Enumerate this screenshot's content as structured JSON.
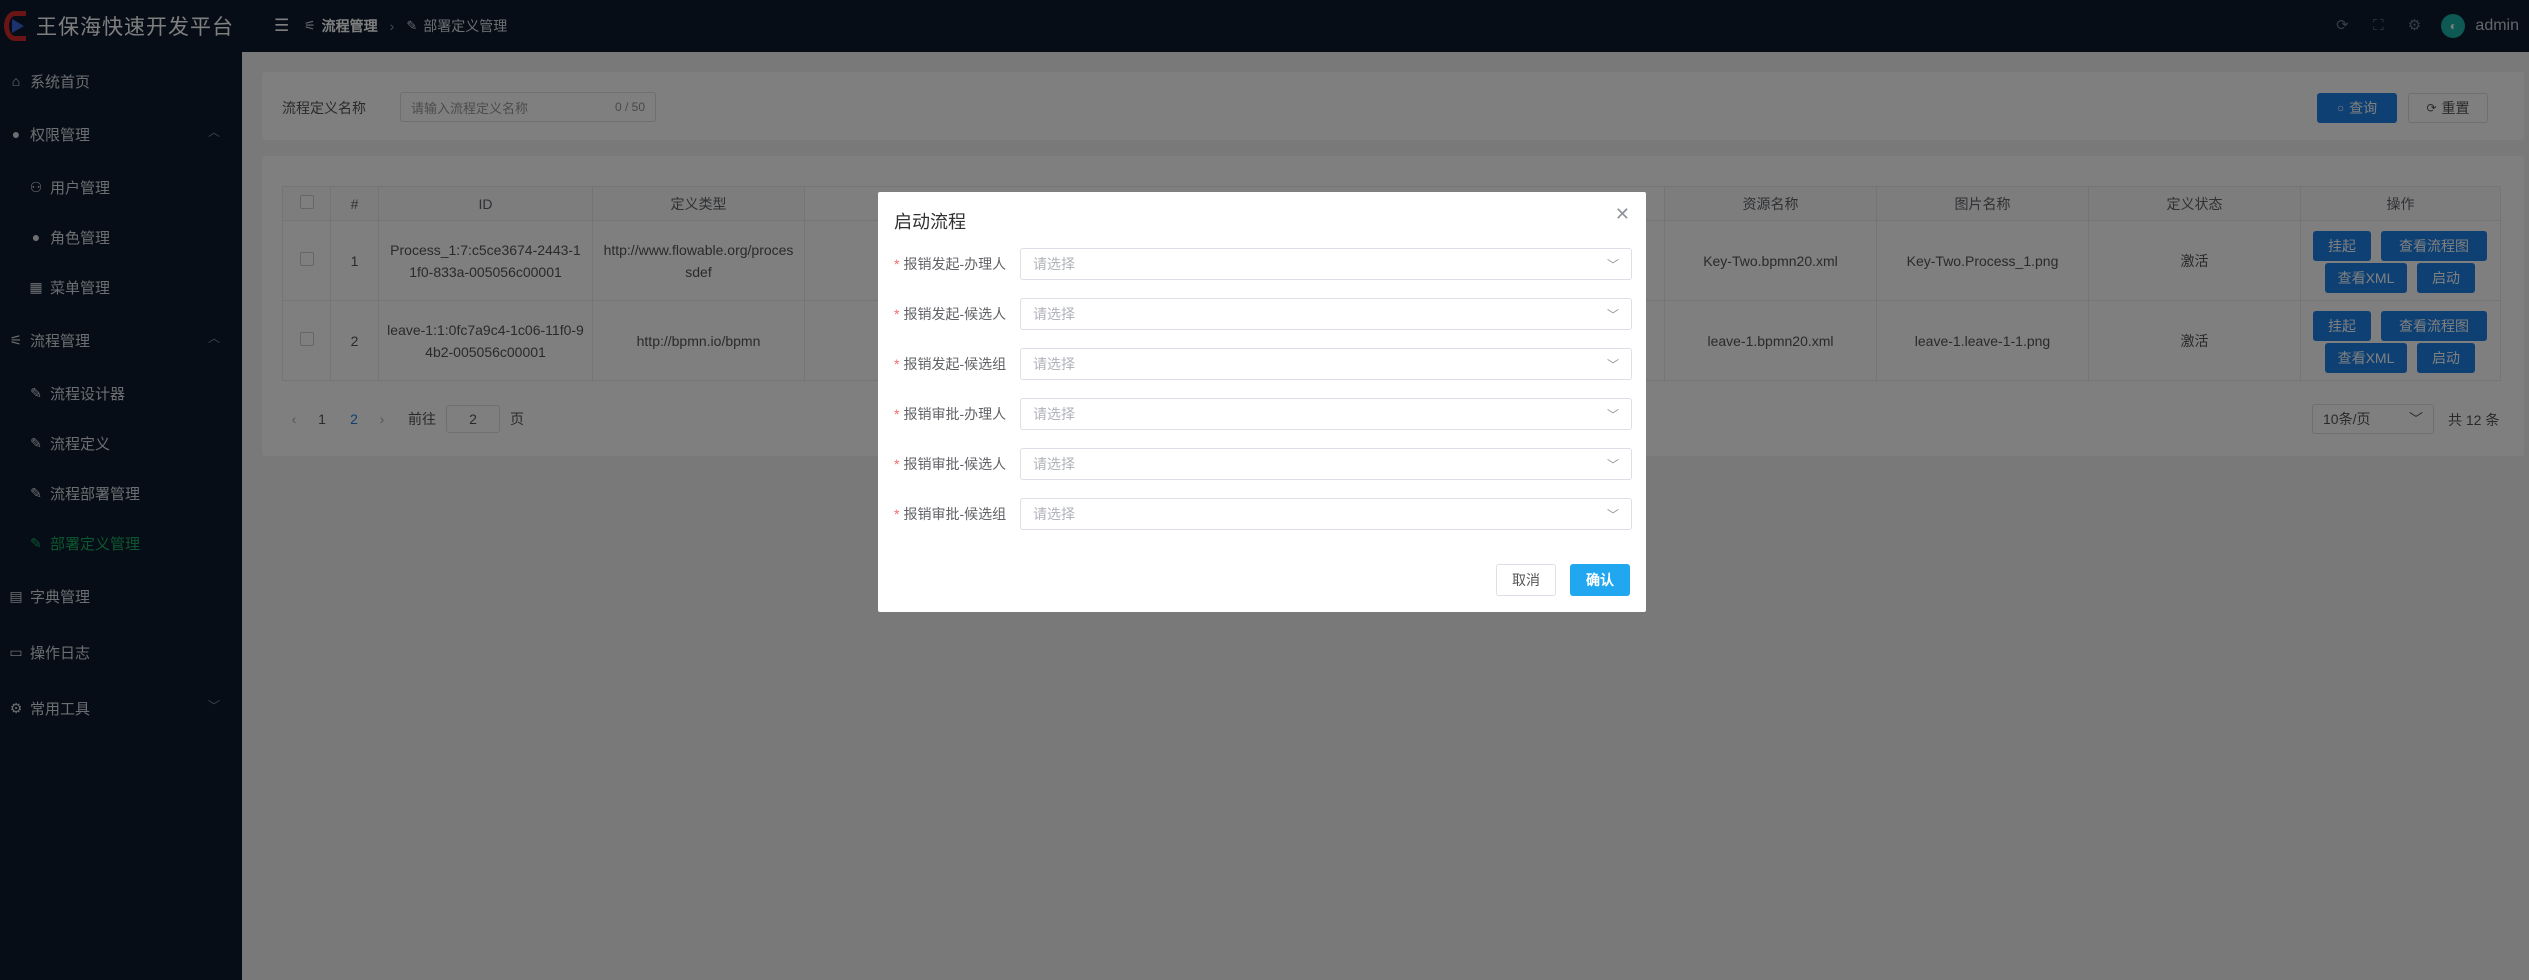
{
  "app": {
    "title": "王保海快速开发平台"
  },
  "header": {
    "breadcrumb": {
      "first": "流程管理",
      "second": "部署定义管理"
    },
    "user": {
      "name": "admin"
    },
    "icons": [
      "refresh-icon",
      "fullscreen-icon",
      "settings-icon"
    ]
  },
  "sidebar": {
    "items": [
      {
        "label": "系统首页",
        "icon": "home-icon"
      },
      {
        "label": "权限管理",
        "icon": "user-icon"
      },
      {
        "label": "用户管理",
        "icon": "user-icon"
      },
      {
        "label": "角色管理",
        "icon": "user-icon"
      },
      {
        "label": "菜单管理",
        "icon": "grid-icon"
      },
      {
        "label": "流程管理",
        "icon": "sliders-icon"
      },
      {
        "label": "流程设计器",
        "icon": "edit-icon"
      },
      {
        "label": "流程定义",
        "icon": "edit-icon"
      },
      {
        "label": "流程部署管理",
        "icon": "edit-icon"
      },
      {
        "label": "部署定义管理",
        "icon": "edit-icon"
      },
      {
        "label": "字典管理",
        "icon": "clipboard-icon"
      },
      {
        "label": "操作日志",
        "icon": "message-icon"
      },
      {
        "label": "常用工具",
        "icon": "gear-icon"
      }
    ]
  },
  "search": {
    "label": "流程定义名称",
    "placeholder": "请输入流程定义名称",
    "count": "0 / 50",
    "query_label": "查询",
    "reset_label": "重置"
  },
  "table": {
    "headers": [
      "#",
      "ID",
      "定义类型",
      "资源名称",
      "图片名称",
      "定义状态",
      "操作"
    ],
    "rows": [
      {
        "index": "1",
        "id": "Process_1:7:c5ce3674-2443-11f0-833a-005056c00001",
        "type": "http://www.flowable.org/processdef",
        "resource": "Key-Two.bpmn20.xml",
        "image": "Key-Two.Process_1.png",
        "status": "激活"
      },
      {
        "index": "2",
        "id": "leave-1:1:0fc7a9c4-1c06-11f0-94b2-005056c00001",
        "type": "http://bpmn.io/bpmn",
        "resource": "leave-1.bpmn20.xml",
        "image": "leave-1.leave-1-1.png",
        "status": "激活"
      }
    ],
    "actions": {
      "suspend": "挂起",
      "view_diagram": "查看流程图",
      "view_xml": "查看XML",
      "start": "启动"
    }
  },
  "pagination": {
    "pages": [
      "1",
      "2"
    ],
    "current": "2",
    "goto_prefix": "前往",
    "goto_value": "2",
    "goto_suffix": "页",
    "page_size": "10条/页",
    "total": "共 12 条"
  },
  "dialog": {
    "title": "启动流程",
    "fields": [
      {
        "label": "报销发起-办理人",
        "placeholder": "请选择"
      },
      {
        "label": "报销发起-候选人",
        "placeholder": "请选择"
      },
      {
        "label": "报销发起-候选组",
        "placeholder": "请选择"
      },
      {
        "label": "报销审批-办理人",
        "placeholder": "请选择"
      },
      {
        "label": "报销审批-候选人",
        "placeholder": "请选择"
      },
      {
        "label": "报销审批-候选组",
        "placeholder": "请选择"
      }
    ],
    "cancel_label": "取消",
    "confirm_label": "确认"
  }
}
